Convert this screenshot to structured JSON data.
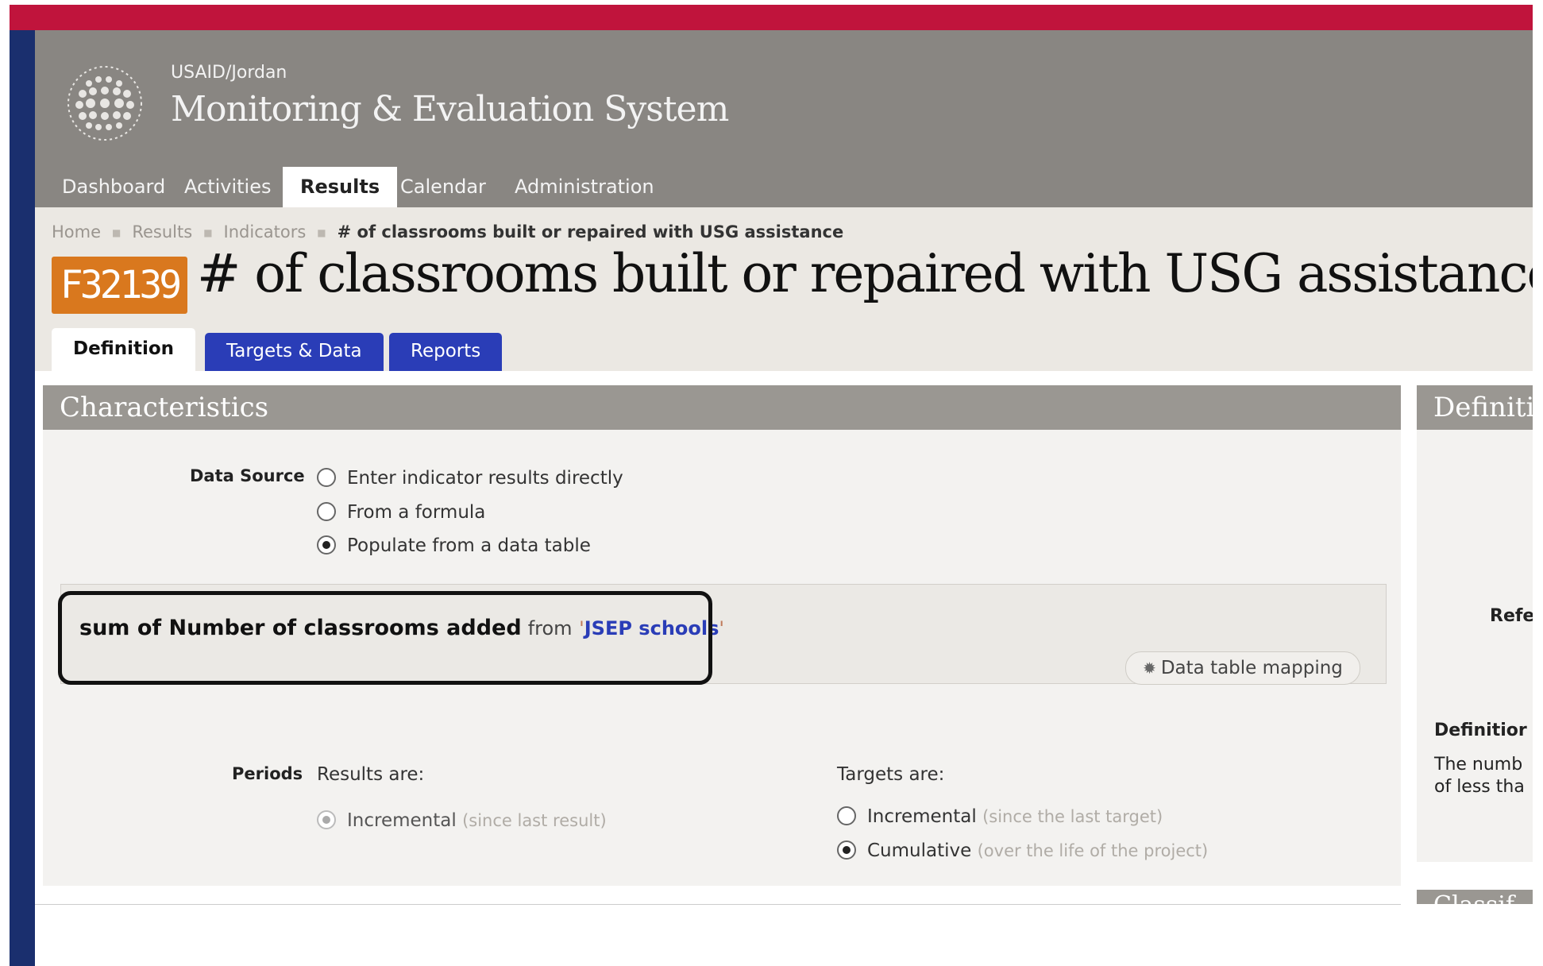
{
  "header": {
    "org": "USAID/Jordan",
    "system_name": "Monitoring & Evaluation System"
  },
  "nav": {
    "items": [
      {
        "label": "Dashboard"
      },
      {
        "label": "Activities"
      },
      {
        "label": "Results"
      },
      {
        "label": "Calendar"
      },
      {
        "label": "Administration"
      }
    ]
  },
  "breadcrumb": {
    "items": [
      "Home",
      "Results",
      "Indicators"
    ],
    "current": "# of classrooms built or repaired with USG assistance"
  },
  "indicator": {
    "code": "F32139",
    "title": "# of classrooms built or repaired with USG assistance"
  },
  "tabs": [
    {
      "label": "Definition"
    },
    {
      "label": "Targets & Data"
    },
    {
      "label": "Reports"
    }
  ],
  "characteristics": {
    "heading": "Characteristics",
    "data_source_label": "Data Source",
    "data_source_options": [
      {
        "label": "Enter indicator results directly",
        "checked": false
      },
      {
        "label": "From a formula",
        "checked": false
      },
      {
        "label": "Populate from a data table",
        "checked": true
      }
    ],
    "mapping": {
      "sum_text": "sum of Number of classrooms added",
      "from_text": "from",
      "quote_open": "'",
      "table_name": "JSEP schools",
      "quote_close": "'",
      "button_label": "Data table mapping",
      "button_icon": "gear-icon"
    },
    "periods_label": "Periods",
    "results_are": "Results are:",
    "results_option": {
      "label": "Incremental",
      "hint": "(since last result)"
    },
    "targets_are": "Targets are:",
    "targets_options": [
      {
        "label": "Incremental",
        "hint": "(since the last target)",
        "checked": false
      },
      {
        "label": "Cumulative",
        "hint": "(over the life of the project)",
        "checked": true
      }
    ]
  },
  "right_panel": {
    "heading": "Definiti",
    "ref_label": "Refe",
    "definition_label": "Definitior",
    "definition_line1": "The numb",
    "definition_line2": "of less tha",
    "next_heading": "Classif"
  },
  "colors": {
    "brand_red": "#c0143c",
    "brand_blue": "#1a2f6e",
    "tab_blue": "#2a3db7",
    "badge_orange": "#d9781e"
  }
}
